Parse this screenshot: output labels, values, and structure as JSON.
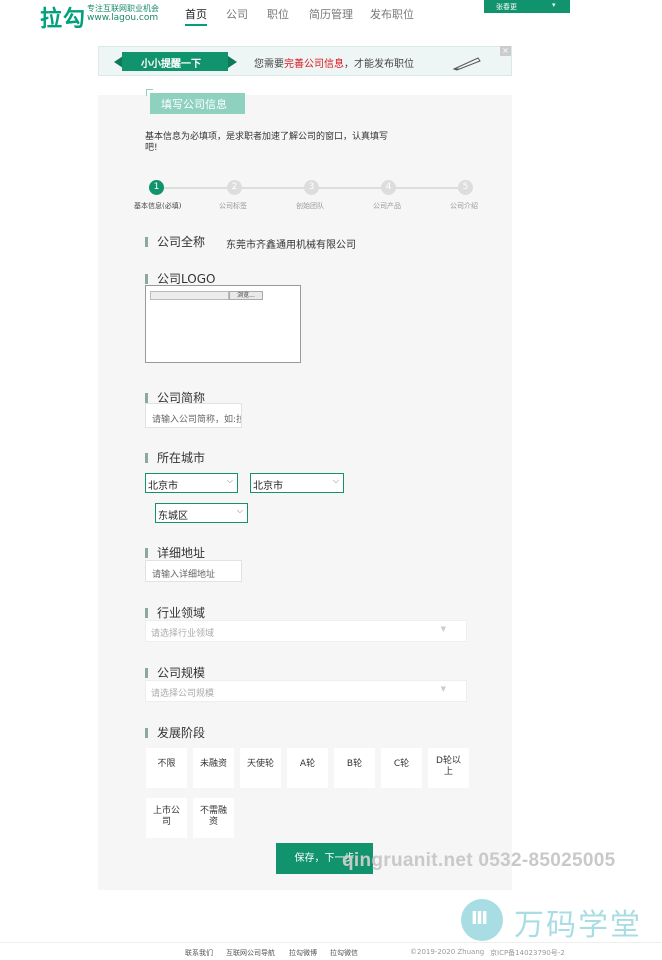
{
  "header": {
    "logo": "拉勾",
    "tagline": "专注互联网职业机会",
    "url": "www.lagou.com",
    "nav": [
      "首页",
      "公司",
      "职位",
      "简历管理",
      "发布职位"
    ],
    "user_name": "张春更",
    "caret": "▾"
  },
  "notice": {
    "ribbon": "小小提醒一下",
    "text_before": "您需要",
    "text_highlight": "完善公司信息",
    "text_after": "，才能发布职位",
    "close": "×"
  },
  "title": "填写公司信息",
  "intro": "基本信息为必填项，是求职者加速了解公司的窗口，认真填写吧!",
  "steps": [
    {
      "num": "1",
      "label": "基本信息(必填)"
    },
    {
      "num": "2",
      "label": "公司标签"
    },
    {
      "num": "3",
      "label": "创始团队"
    },
    {
      "num": "4",
      "label": "公司产品"
    },
    {
      "num": "5",
      "label": "公司介绍"
    }
  ],
  "form": {
    "full_name_label": "公司全称",
    "full_name_value": "东莞市齐鑫通用机械有限公司",
    "logo_label": "公司LOGO",
    "browse_label": "浏览...",
    "short_name_label": "公司简称",
    "short_name_placeholder": "请输入公司简称，如:拉勾",
    "city_label": "所在城市",
    "province": "北京市",
    "city": "北京市",
    "district": "东城区",
    "address_label": "详细地址",
    "address_placeholder": "请输入详细地址",
    "industry_label": "行业领域",
    "industry_placeholder": "请选择行业领域",
    "scale_label": "公司规模",
    "scale_placeholder": "请选择公司规模",
    "stage_label": "发展阶段",
    "stages_row1": [
      "不限",
      "未融资",
      "天使轮",
      "A轮",
      "B轮",
      "C轮",
      "D轮以上"
    ],
    "stages_row2": [
      "上市公司",
      "不需融资"
    ],
    "save_label": "保存，下一步"
  },
  "watermark": {
    "text": "qingruanit.net 0532-85025005",
    "brand": "万码学堂",
    "brand_icon": "m-logo-icon"
  },
  "footer": {
    "links": [
      "联系我们",
      "互联网公司导航",
      "拉勾微博",
      "拉勾微信"
    ],
    "copyright": "©2019-2020 Zhuang",
    "icp": "京ICP备14023790号-2"
  },
  "colors": {
    "brand": "#11946d",
    "highlight": "#d9131d",
    "tag": "#8ed1be"
  }
}
